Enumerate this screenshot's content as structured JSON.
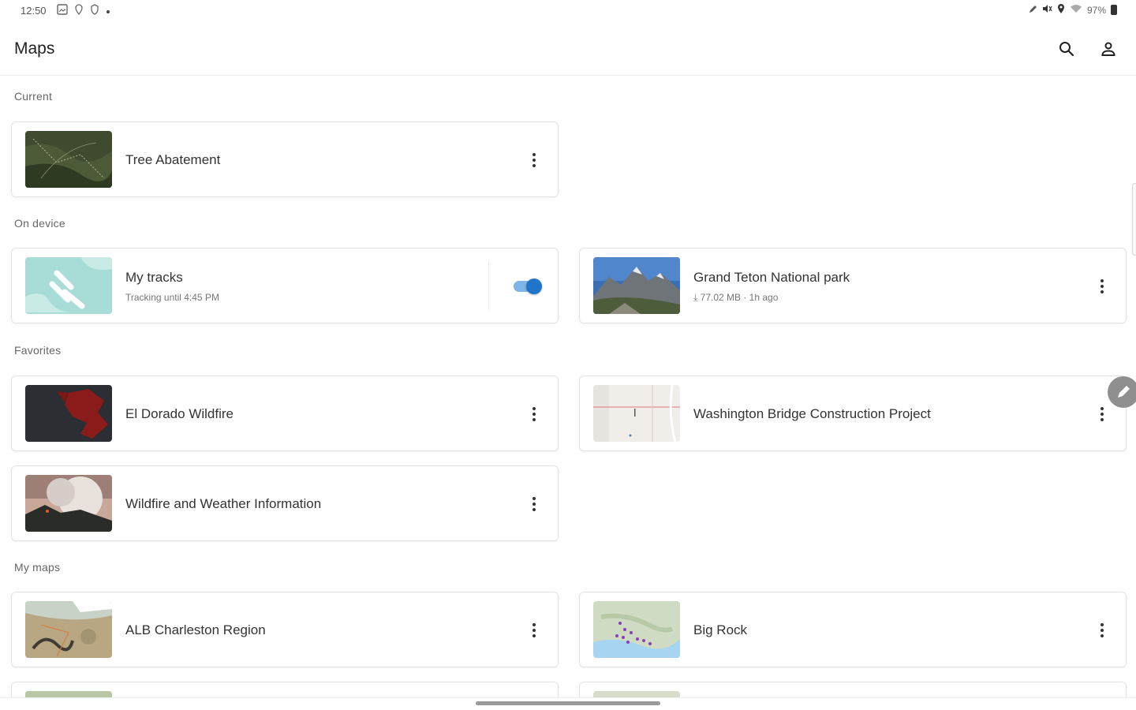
{
  "status_bar": {
    "time": "12:50",
    "battery": "97%",
    "left_icons": [
      "image-icon",
      "location-pin-icon",
      "shield-icon"
    ],
    "right_icons": [
      "pencil-icon",
      "mute-icon",
      "location-icon",
      "wifi-icon",
      "battery-icon"
    ]
  },
  "app_bar": {
    "title": "Maps",
    "actions": [
      "search-icon",
      "account-icon"
    ]
  },
  "sections": {
    "current": "Current",
    "on_device": "On device",
    "favorites": "Favorites",
    "my_maps": "My maps"
  },
  "cards": {
    "tree_abatement": {
      "title": "Tree Abatement"
    },
    "my_tracks": {
      "title": "My tracks",
      "subtitle": "Tracking until 4:45 PM",
      "toggle_on": true
    },
    "grand_teton": {
      "title": "Grand Teton National park",
      "subtitle": "77.02 MB · 1h ago"
    },
    "el_dorado": {
      "title": "El Dorado Wildfire"
    },
    "washington_bridge": {
      "title": "Washington Bridge Construction Project"
    },
    "wildfire_weather": {
      "title": "Wildfire and Weather Information"
    },
    "alb_charleston": {
      "title": "ALB Charleston Region"
    },
    "big_rock": {
      "title": "Big Rock"
    }
  },
  "colors": {
    "accent": "#1f76c9",
    "accent_track": "#7fb4e6",
    "fire_red": "#8b1a1a"
  }
}
